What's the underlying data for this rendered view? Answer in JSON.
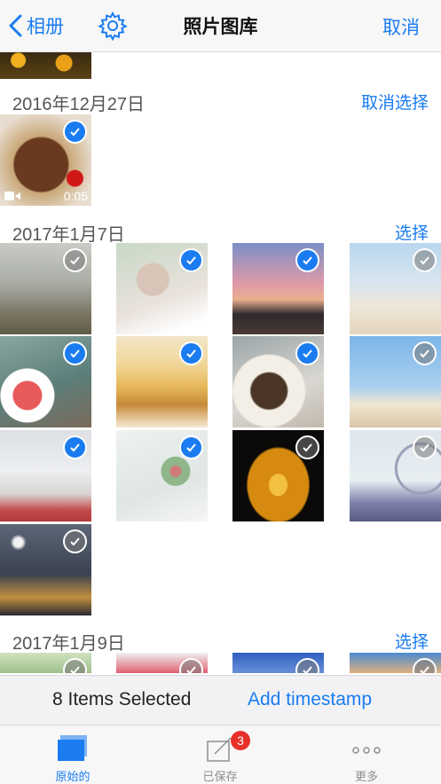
{
  "nav": {
    "back_label": "相册",
    "title": "照片图库",
    "cancel_label": "取消"
  },
  "sections": [
    {
      "date": "2016年12月27日",
      "action": "取消选择"
    },
    {
      "date": "2017年1月7日",
      "action": "选择"
    },
    {
      "date": "2017年1月9日",
      "action": "选择"
    }
  ],
  "video": {
    "duration": "0:05"
  },
  "photos": [
    {
      "subject": "strawberry-cake-video",
      "selected": true
    },
    {
      "subject": "deer",
      "selected": false
    },
    {
      "subject": "pink-tree",
      "selected": true
    },
    {
      "subject": "horses-sunset",
      "selected": true
    },
    {
      "subject": "beach-people",
      "selected": false
    },
    {
      "subject": "strawberry-tart",
      "selected": true
    },
    {
      "subject": "mille-feuille",
      "selected": true
    },
    {
      "subject": "cheesecake",
      "selected": true
    },
    {
      "subject": "kangaroo",
      "selected": false
    },
    {
      "subject": "bride",
      "selected": true
    },
    {
      "subject": "succulent",
      "selected": true
    },
    {
      "subject": "eiffel-tower",
      "selected": false
    },
    {
      "subject": "ferris-wheel",
      "selected": false
    },
    {
      "subject": "night-city",
      "selected": false
    }
  ],
  "selection_bar": {
    "count_text": "8 Items Selected",
    "add_timestamp_label": "Add timestamp"
  },
  "tabs": [
    {
      "label": "原始的",
      "icon": "photos-stack-icon",
      "active": true
    },
    {
      "label": "已保存",
      "icon": "edit-icon",
      "badge": "3",
      "active": false
    },
    {
      "label": "更多",
      "icon": "more-dots-icon",
      "active": false
    }
  ],
  "colors": {
    "accent": "#1a7cf0",
    "badge": "#e8302a",
    "inactive_tab": "#8e8e93"
  }
}
